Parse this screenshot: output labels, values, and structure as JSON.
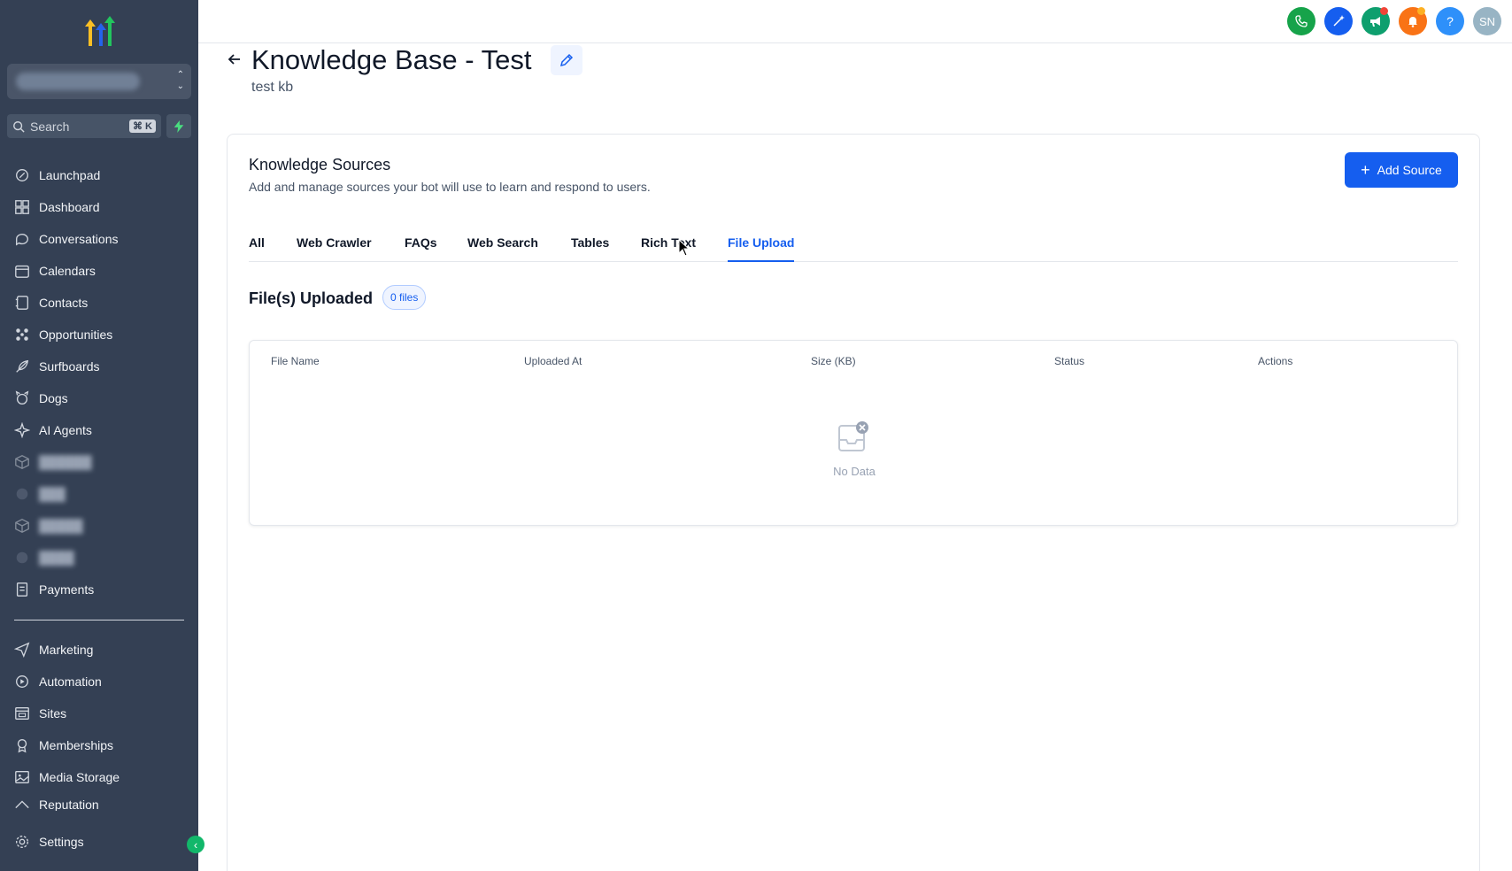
{
  "sidebar": {
    "search_placeholder": "Search",
    "search_shortcut": "⌘ K",
    "items": [
      {
        "label": "Launchpad",
        "icon": "rocket-icon"
      },
      {
        "label": "Dashboard",
        "icon": "grid-icon"
      },
      {
        "label": "Conversations",
        "icon": "chat-icon"
      },
      {
        "label": "Calendars",
        "icon": "calendar-icon"
      },
      {
        "label": "Contacts",
        "icon": "contacts-icon"
      },
      {
        "label": "Opportunities",
        "icon": "pipeline-icon"
      },
      {
        "label": "Surfboards",
        "icon": "feather-icon"
      },
      {
        "label": "Dogs",
        "icon": "paw-icon"
      },
      {
        "label": "AI Agents",
        "icon": "sparkle-icon"
      },
      {
        "label": "Payments",
        "icon": "receipt-icon"
      },
      {
        "label": "Marketing",
        "icon": "send-icon"
      },
      {
        "label": "Automation",
        "icon": "automation-icon"
      },
      {
        "label": "Sites",
        "icon": "sites-icon"
      },
      {
        "label": "Memberships",
        "icon": "award-icon"
      },
      {
        "label": "Media Storage",
        "icon": "image-icon"
      },
      {
        "label": "Reputation",
        "icon": "reputation-icon"
      },
      {
        "label": "Settings",
        "icon": "gear-icon"
      }
    ]
  },
  "topbar": {
    "avatar_initials": "SN",
    "help_label": "?",
    "colors": {
      "phone": "#16a34a",
      "magic": "#155eef",
      "announce": "#0e9f6e",
      "notifications": "#f97316",
      "help": "#2e90fa",
      "avatar": "#98b4c4"
    }
  },
  "page": {
    "title": "Knowledge Base - Test",
    "subtitle": "test kb"
  },
  "card": {
    "title": "Knowledge Sources",
    "description": "Add and manage sources your bot will use to learn and respond to users.",
    "add_button": "Add Source",
    "tabs": [
      "All",
      "Web Crawler",
      "FAQs",
      "Web Search",
      "Tables",
      "Rich Text",
      "File Upload"
    ],
    "active_tab": "File Upload",
    "section_title": "File(s) Uploaded",
    "file_count": "0 files",
    "table": {
      "columns": [
        "File Name",
        "Uploaded At",
        "Size (KB)",
        "Status",
        "Actions"
      ],
      "empty_text": "No Data"
    }
  },
  "colors": {
    "sidebar_bg": "#344054",
    "accent": "#155eef",
    "collapse": "#12b76a"
  }
}
